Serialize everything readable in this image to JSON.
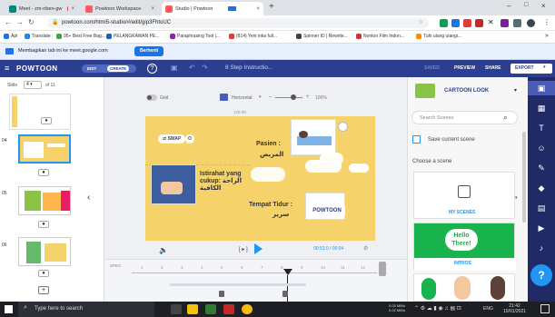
{
  "browser": {
    "tabs": [
      {
        "label": "Meet - zm-nben-gw",
        "fav": "#00897b"
      },
      {
        "label": "Powtoon Workspace",
        "fav": "#ff5a5f"
      },
      {
        "label": "Studio | Powtoon",
        "fav": "#ff5a5f"
      }
    ],
    "new_tab": "+",
    "url": "powtoon.com/html5-studio/#/edit/gip3FhtoUC",
    "bookmarks": [
      "Apl",
      "Translate",
      "95+ Best Free Bag...",
      "PELANGKAWAN PE...",
      "Paraphrasing Tool |...",
      "(814) Yeni inka full...",
      "Spinner ID | Rewrite...",
      "Nonton Film Indon...",
      "Tuhi ulang ulangi..."
    ],
    "more_bookmarks": "»",
    "info_text": "Membagikan tab ini ke meet.google.com",
    "info_button": "Berhenti"
  },
  "header": {
    "logo": "POWTOON",
    "edit": "EDIT",
    "create": "CREATE",
    "title": "8 Step Instructio...",
    "saved": "SAVED",
    "preview": "PREVIEW",
    "share": "SHARE",
    "export": "EXPORT"
  },
  "sidebar": {
    "slide_label": "Slide",
    "slide_num": "4",
    "slide_total": "of 11",
    "slide_numbers": [
      "04",
      "05",
      "06"
    ],
    "add": "+"
  },
  "stage": {
    "grid": "Grid",
    "orientation": "Horizontal",
    "zoom": "100%",
    "dims": "128:98",
    "swap": "SWAP",
    "text_pasien": "Pasien :",
    "text_pasien_ar": "المريض",
    "text_istirahat": "Istirahat yang cukup: الراحة الكافية",
    "text_tempat": "Tempat Tidur :",
    "text_tempat_ar": "سرير",
    "logo": "POWTOON",
    "time": "00:53.0 / 00:04",
    "play_bracket": "[ ▸ ]",
    "timeline_label": "SPEC",
    "ticks": [
      "1",
      "2",
      "3",
      "4",
      "5",
      "6",
      "7",
      "8",
      "9",
      "10",
      "11",
      "12"
    ]
  },
  "right": {
    "category": "CARTOON LOOK",
    "search_placeholder": "Search Scenes",
    "save_scene": "Save current scene",
    "choose": "Choose a scene",
    "my_scenes": "MY SCENES",
    "hello": "Hello There!",
    "intros": "INTROS"
  },
  "rtools": {
    "help": "?"
  },
  "taskbar": {
    "search": "Type here to search",
    "net": "0.03 MB/s\n0.02 MB/s",
    "lang": "ENG",
    "time": "21:42",
    "date": "10/01/2021"
  },
  "colors": {
    "brand_navy": "#2c3e8f",
    "scene_yellow": "#f5d36a",
    "accent_blue": "#2196f3",
    "green": "#19b34d"
  }
}
